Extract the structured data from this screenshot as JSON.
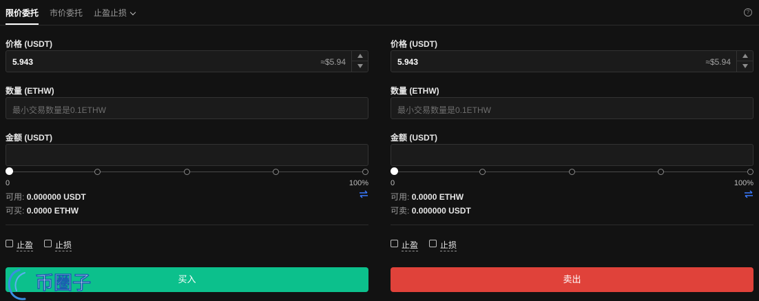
{
  "tabs": {
    "limit": "限价委托",
    "market": "市价委托",
    "tpsl": "止盈止损"
  },
  "help_symbol": "?",
  "colors": {
    "buy": "#0cc08c",
    "sell": "#e0423a",
    "accent_blue": "#3a7bff"
  },
  "buy": {
    "price_label": "价格 (USDT)",
    "price_value": "5.943",
    "price_approx": "≈$5.94",
    "qty_label": "数量 (ETHW)",
    "qty_placeholder": "最小交易数量是0.1ETHW",
    "amount_label": "金额 (USDT)",
    "slider_min": "0",
    "slider_max": "100%",
    "slider_percent": 0,
    "available_label": "可用:",
    "available_value": "0.000000 USDT",
    "can_label": "可买:",
    "can_value": "0.0000 ETHW",
    "tp_label": "止盈",
    "sl_label": "止损",
    "action_label": "买入"
  },
  "sell": {
    "price_label": "价格 (USDT)",
    "price_value": "5.943",
    "price_approx": "≈$5.94",
    "qty_label": "数量 (ETHW)",
    "qty_placeholder": "最小交易数量是0.1ETHW",
    "amount_label": "金额 (USDT)",
    "slider_min": "0",
    "slider_max": "100%",
    "slider_percent": 0,
    "available_label": "可用:",
    "available_value": "0.0000 ETHW",
    "can_label": "可卖:",
    "can_value": "0.000000 USDT",
    "tp_label": "止盈",
    "sl_label": "止损",
    "action_label": "卖出"
  },
  "watermark": {
    "text": "币圈子"
  }
}
